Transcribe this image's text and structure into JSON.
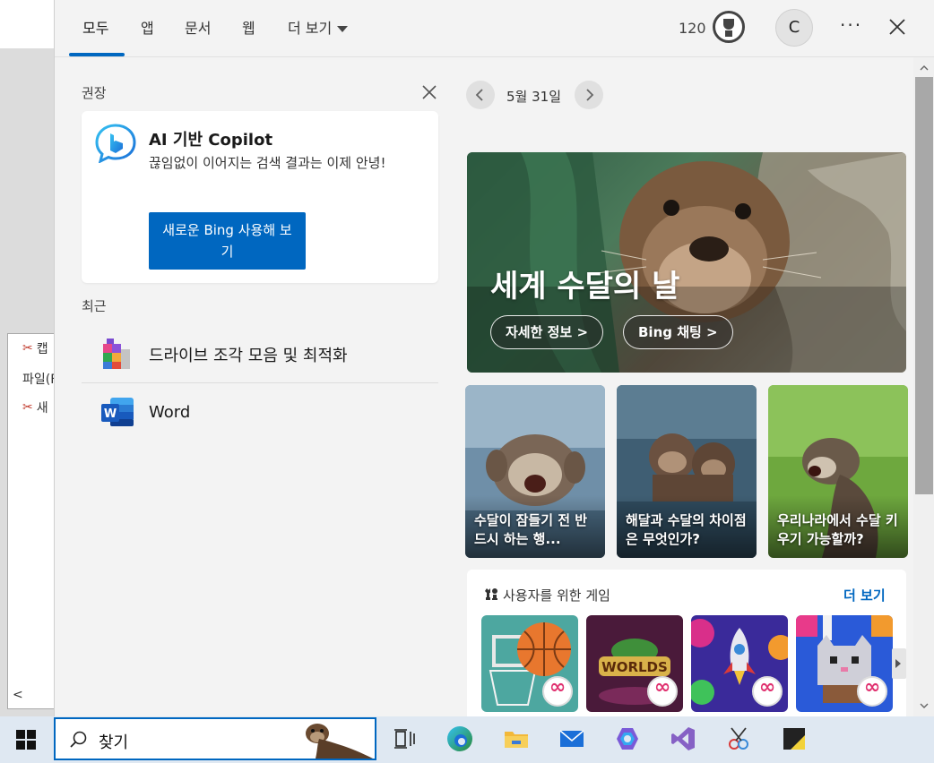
{
  "background_window": {
    "title_fragment": "캡",
    "menu_fragment": "파일(F",
    "new_fragment": "새",
    "scroll_left": "<"
  },
  "tabs": [
    {
      "label": "모두",
      "active": true
    },
    {
      "label": "앱"
    },
    {
      "label": "문서"
    },
    {
      "label": "웹"
    },
    {
      "label": "더 보기"
    }
  ],
  "header": {
    "points": "120",
    "avatar_initial": "C",
    "more_label": "···"
  },
  "recommended": {
    "heading": "권장",
    "card": {
      "title": "AI 기반 Copilot",
      "text": "끊임없이 이어지는 검색 결과는 이제 안녕!",
      "button_label": "새로운 Bing 사용해 보기"
    }
  },
  "recent": {
    "heading": "최근",
    "items": [
      {
        "label": "드라이브 조각 모음 및 최적화",
        "icon": "defrag-icon"
      },
      {
        "label": "Word",
        "icon": "word-icon"
      }
    ]
  },
  "feed": {
    "date": "5월 31일",
    "hero": {
      "title": "세계 수달의 날",
      "button_more": "자세한 정보 >",
      "button_chat": "Bing 채팅 >"
    },
    "tiles": [
      {
        "caption": "수달이 잠들기 전 반드시 하는 행..."
      },
      {
        "caption": "해달과 수달의 차이점은 무엇인가?"
      },
      {
        "caption": "우리나라에서 수달 키우기 가능할까?"
      }
    ]
  },
  "games": {
    "title": "사용자를 위한 게임",
    "more_label": "더 보기",
    "items": [
      {
        "name": "basketball-game"
      },
      {
        "name": "worlds-game",
        "label": "WORLDS"
      },
      {
        "name": "rocket-game"
      },
      {
        "name": "cat-game"
      }
    ]
  },
  "taskbar": {
    "search_text": "찾기"
  }
}
